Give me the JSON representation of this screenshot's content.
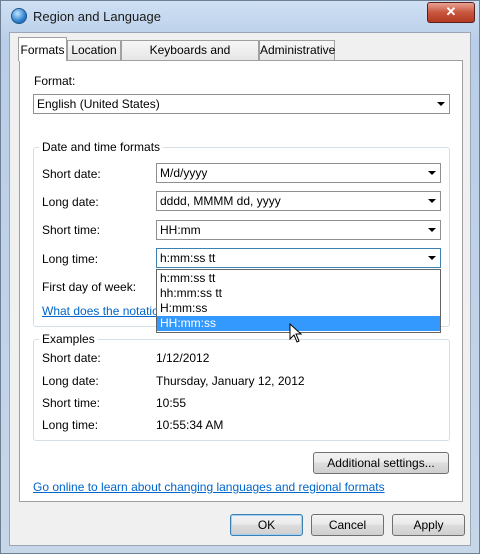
{
  "window": {
    "title": "Region and Language",
    "close_glyph": "✕"
  },
  "tabs": [
    {
      "label": "Formats",
      "active": true
    },
    {
      "label": "Location",
      "active": false
    },
    {
      "label": "Keyboards and Languages",
      "active": false
    },
    {
      "label": "Administrative",
      "active": false
    }
  ],
  "format": {
    "label": "Format:",
    "value": "English (United States)"
  },
  "date_time_formats": {
    "group_title": "Date and time formats",
    "short_date_label": "Short date:",
    "short_date_value": "M/d/yyyy",
    "long_date_label": "Long date:",
    "long_date_value": "dddd, MMMM dd, yyyy",
    "short_time_label": "Short time:",
    "short_time_value": "HH:mm",
    "long_time_label": "Long time:",
    "long_time_value": "h:mm:ss tt",
    "first_day_label": "First day of week:",
    "notation_link": "What does the notatio"
  },
  "long_time_dropdown": {
    "options": [
      "h:mm:ss tt",
      "hh:mm:ss tt",
      "H:mm:ss",
      "HH:mm:ss"
    ],
    "highlighted": "HH:mm:ss"
  },
  "examples": {
    "group_title": "Examples",
    "short_date_label": "Short date:",
    "short_date_value": "1/12/2012",
    "long_date_label": "Long date:",
    "long_date_value": "Thursday, January 12, 2012",
    "short_time_label": "Short time:",
    "short_time_value": "10:55",
    "long_time_label": "Long time:",
    "long_time_value": "10:55:34 AM"
  },
  "additional_settings_label": "Additional settings...",
  "online_link": "Go online to learn about changing languages and regional formats",
  "buttons": {
    "ok": "OK",
    "cancel": "Cancel",
    "apply": "Apply"
  }
}
